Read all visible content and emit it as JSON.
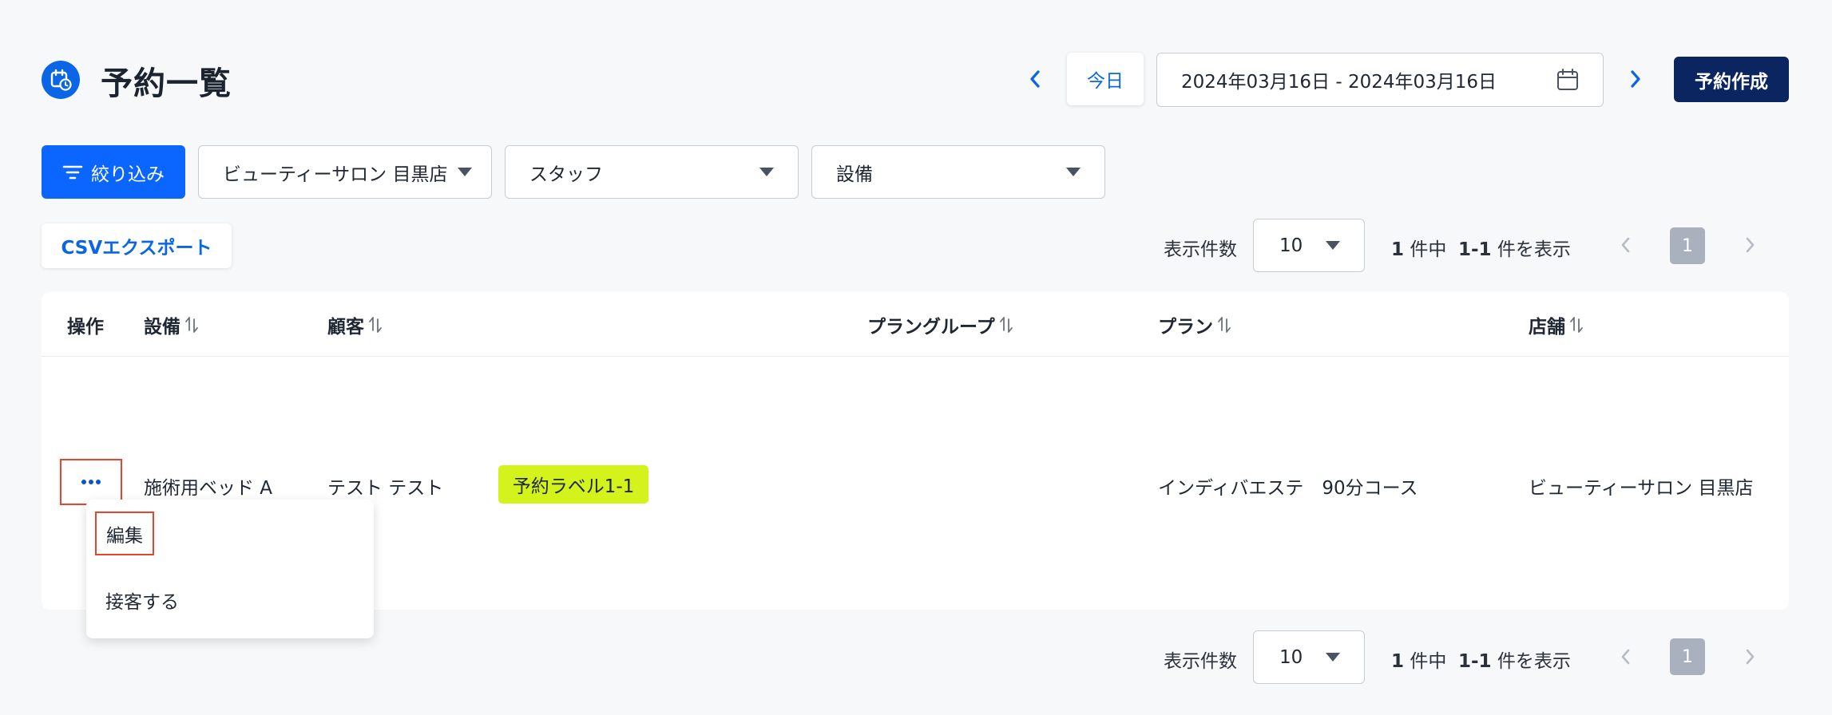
{
  "header": {
    "title": "予約一覧",
    "today_label": "今日",
    "date_range": "2024年03月16日 - 2024年03月16日",
    "create_label": "予約作成"
  },
  "filters": {
    "filter_label": "絞り込み",
    "store": "ビューティーサロン 目黒店",
    "staff": "スタッフ",
    "equipment": "設備"
  },
  "csv_label": "CSVエクスポート",
  "pagination": {
    "per_page_label": "表示件数",
    "per_page_value": "10",
    "total": "1",
    "total_suffix": "件中",
    "range": "1-1",
    "range_suffix": "件を表示",
    "current_page": "1"
  },
  "table": {
    "headers": {
      "ops": "操作",
      "equipment": "設備",
      "customer": "顧客",
      "plan_group": "プラングループ",
      "plan": "プラン",
      "store": "店舗"
    },
    "row": {
      "equipment": "施術用ベッド A",
      "customer": "テスト テスト",
      "label": "予約ラベル1-1",
      "plan_group": "",
      "plan": "インディバエステ　90分コース",
      "store": "ビューティーサロン 目黒店"
    }
  },
  "menu": {
    "edit": "編集",
    "serve": "接客する"
  },
  "colors": {
    "primary": "#0a66ff",
    "navy": "#0b2560",
    "badge": "#d4f21c",
    "highlight": "#e5452e"
  }
}
